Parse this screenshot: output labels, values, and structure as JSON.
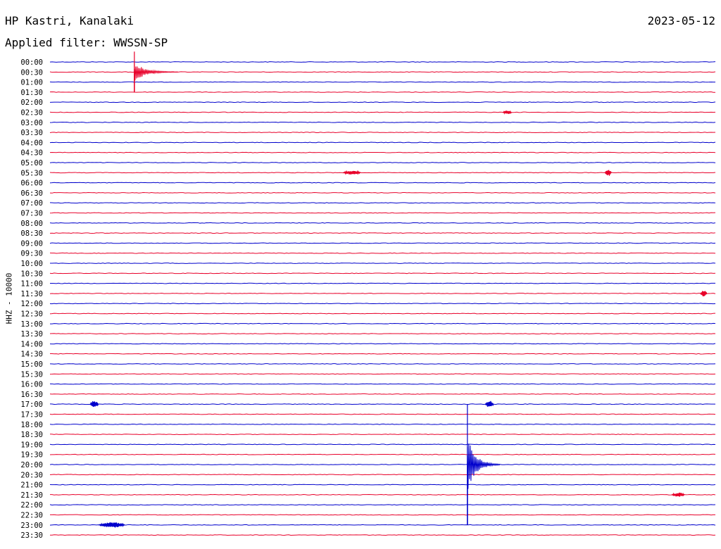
{
  "header": {
    "station": "HP Kastri, Kanalaki",
    "filter": "Applied filter: WWSSN-SP",
    "date": "2023-05-12",
    "channel_label": "HHZ - 10000"
  },
  "colors": {
    "even_row": "#0000cc",
    "odd_row": "#e8002a"
  },
  "chart_data": {
    "type": "helicorder",
    "title": "HP Kastri, Kanalaki",
    "subtitle": "Applied filter: WWSSN-SP",
    "ylabel": "HHZ - 10000",
    "rows": [
      "00:00",
      "00:30",
      "01:00",
      "01:30",
      "02:00",
      "02:30",
      "03:00",
      "03:30",
      "04:00",
      "04:30",
      "05:00",
      "05:30",
      "06:00",
      "06:30",
      "07:00",
      "07:30",
      "08:00",
      "08:30",
      "09:00",
      "09:30",
      "10:00",
      "10:30",
      "11:00",
      "11:30",
      "12:00",
      "12:30",
      "13:00",
      "13:30",
      "14:00",
      "14:30",
      "15:00",
      "15:30",
      "16:00",
      "16:30",
      "17:00",
      "17:30",
      "18:00",
      "18:30",
      "19:00",
      "19:30",
      "20:00",
      "20:30",
      "21:00",
      "21:30",
      "22:00",
      "22:30",
      "23:00",
      "23:30"
    ],
    "minutes_per_row": 30,
    "events": [
      {
        "row": 1,
        "minute": 3.8,
        "amplitude": 29,
        "duration": 2.0,
        "type": "quake"
      },
      {
        "row": 5,
        "minute": 20.4,
        "amplitude": 3,
        "duration": 0.4,
        "type": "burst"
      },
      {
        "row": 11,
        "minute": 13.2,
        "amplitude": 3,
        "duration": 0.8,
        "type": "burst"
      },
      {
        "row": 11,
        "minute": 25.0,
        "amplitude": 5,
        "duration": 0.3,
        "type": "burst"
      },
      {
        "row": 23,
        "minute": 29.3,
        "amplitude": 5,
        "duration": 0.3,
        "type": "burst"
      },
      {
        "row": 34,
        "minute": 1.8,
        "amplitude": 5,
        "duration": 0.4,
        "type": "burst"
      },
      {
        "row": 34,
        "minute": 19.6,
        "amplitude": 5,
        "duration": 0.4,
        "type": "burst"
      },
      {
        "row": 40,
        "minute": 18.8,
        "amplitude": 86,
        "duration": 1.5,
        "type": "quake"
      },
      {
        "row": 43,
        "minute": 28.0,
        "amplitude": 3,
        "duration": 0.6,
        "type": "burst"
      },
      {
        "row": 46,
        "minute": 2.2,
        "amplitude": 4,
        "duration": 1.2,
        "type": "burst"
      }
    ],
    "grid": false
  }
}
